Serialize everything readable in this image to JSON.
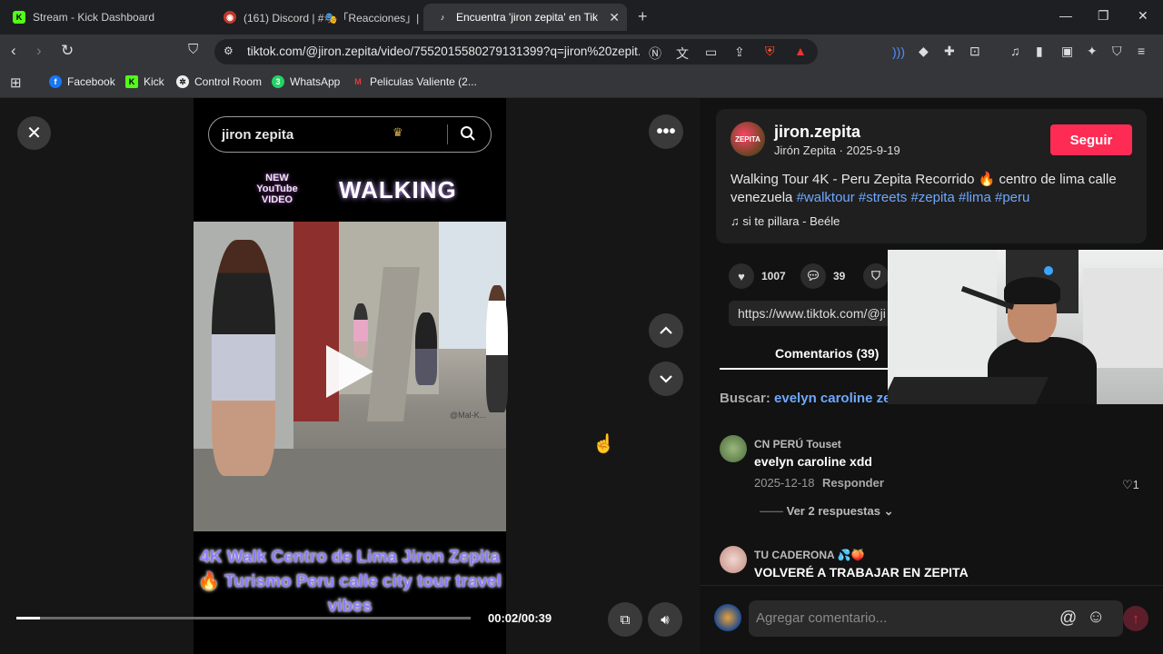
{
  "tabs": [
    {
      "title": "Stream - Kick Dashboard",
      "icon": "kick-icon"
    },
    {
      "title": "(161) Discord | #🎭「Reacciones」| B",
      "icon": "discord-icon"
    },
    {
      "title": "Encuentra 'jiron zepita' en Tik",
      "icon": "tiktok-icon"
    }
  ],
  "address": {
    "url": "tiktok.com/@jiron.zepita/video/7552015580279131399?q=jiron%20zepit..."
  },
  "bookmarks": [
    {
      "label": "Facebook",
      "color": "#1877f2"
    },
    {
      "label": "Kick",
      "color": "#53fc18"
    },
    {
      "label": "Control Room",
      "color": "#444444"
    },
    {
      "label": "WhatsApp",
      "color": "#25d366"
    },
    {
      "label": "Peliculas Valiente (2...",
      "color": "#c62828"
    }
  ],
  "video": {
    "search_query": "jiron zepita",
    "badge_text": "NEW YouTube VIDEO",
    "overlay_title": "WALKING",
    "watermark": "@Mal-K...",
    "caption": "4K Walk Centro de Lima Jiron Zepita 🔥 Turismo Peru calle city tour travel vibes",
    "time": "00:02/00:39",
    "progress": 0.051
  },
  "post": {
    "username": "jiron.zepita",
    "subtitle": "Jirón Zepita · 2025-9-19",
    "follow_label": "Seguir",
    "description_text": "Walking Tour 4K - Peru Zepita Recorrido 🔥 centro de lima calle venezuela ",
    "hashtags": "#walktour #streets #zepita #lima #peru",
    "music": "si te pillara - Beéle",
    "likes": "1007",
    "comments": "39",
    "link": "https://www.tiktok.com/@ji"
  },
  "comments_tab": {
    "label": "Comentarios (39)"
  },
  "search_suggestion": {
    "prefix": "Buscar: ",
    "keyword": "evelyn caroline ze"
  },
  "comment_list": [
    {
      "author": "CN PERÚ Touset",
      "text": "evelyn caroline xdd",
      "date": "2025-12-18",
      "reply_label": "Responder",
      "likes": "1",
      "view_replies": "Ver 2 respuestas"
    },
    {
      "author": "TU CADERONA 💦🍑",
      "text": "VOLVERÉ A TRABAJAR EN ZEPITA"
    }
  ],
  "comment_input": {
    "placeholder": "Agregar comentario..."
  }
}
